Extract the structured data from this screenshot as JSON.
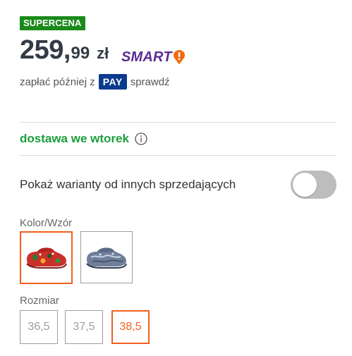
{
  "badge": {
    "label": "SUPERCENA",
    "color": "#1a8a1a"
  },
  "price": {
    "integer": "259",
    "comma": ",",
    "decimal": "99",
    "currency": "zł"
  },
  "smart": {
    "label": "SMART",
    "icon": "exclamation-icon",
    "color": "#5a2d91",
    "accent": "#f26a10"
  },
  "pay_later": {
    "prefix": "zapłać później z",
    "badge": "PAY",
    "link": "sprawdź"
  },
  "delivery": {
    "label": "dostawa we wtorek",
    "icon": "info-icon",
    "color": "#1a9e3b"
  },
  "variants_toggle": {
    "label": "Pokaż warianty od innych sprzedających",
    "enabled": false
  },
  "color_pattern": {
    "label": "Kolor/Wzór",
    "options": [
      {
        "name": "red-floral-clog",
        "selected": true
      },
      {
        "name": "blue-marble-clog",
        "selected": false
      }
    ]
  },
  "size": {
    "label": "Rozmiar",
    "options": [
      {
        "label": "36,5",
        "selected": false
      },
      {
        "label": "37,5",
        "selected": false
      },
      {
        "label": "38,5",
        "selected": true
      }
    ]
  },
  "accent_color": "#f0601c"
}
